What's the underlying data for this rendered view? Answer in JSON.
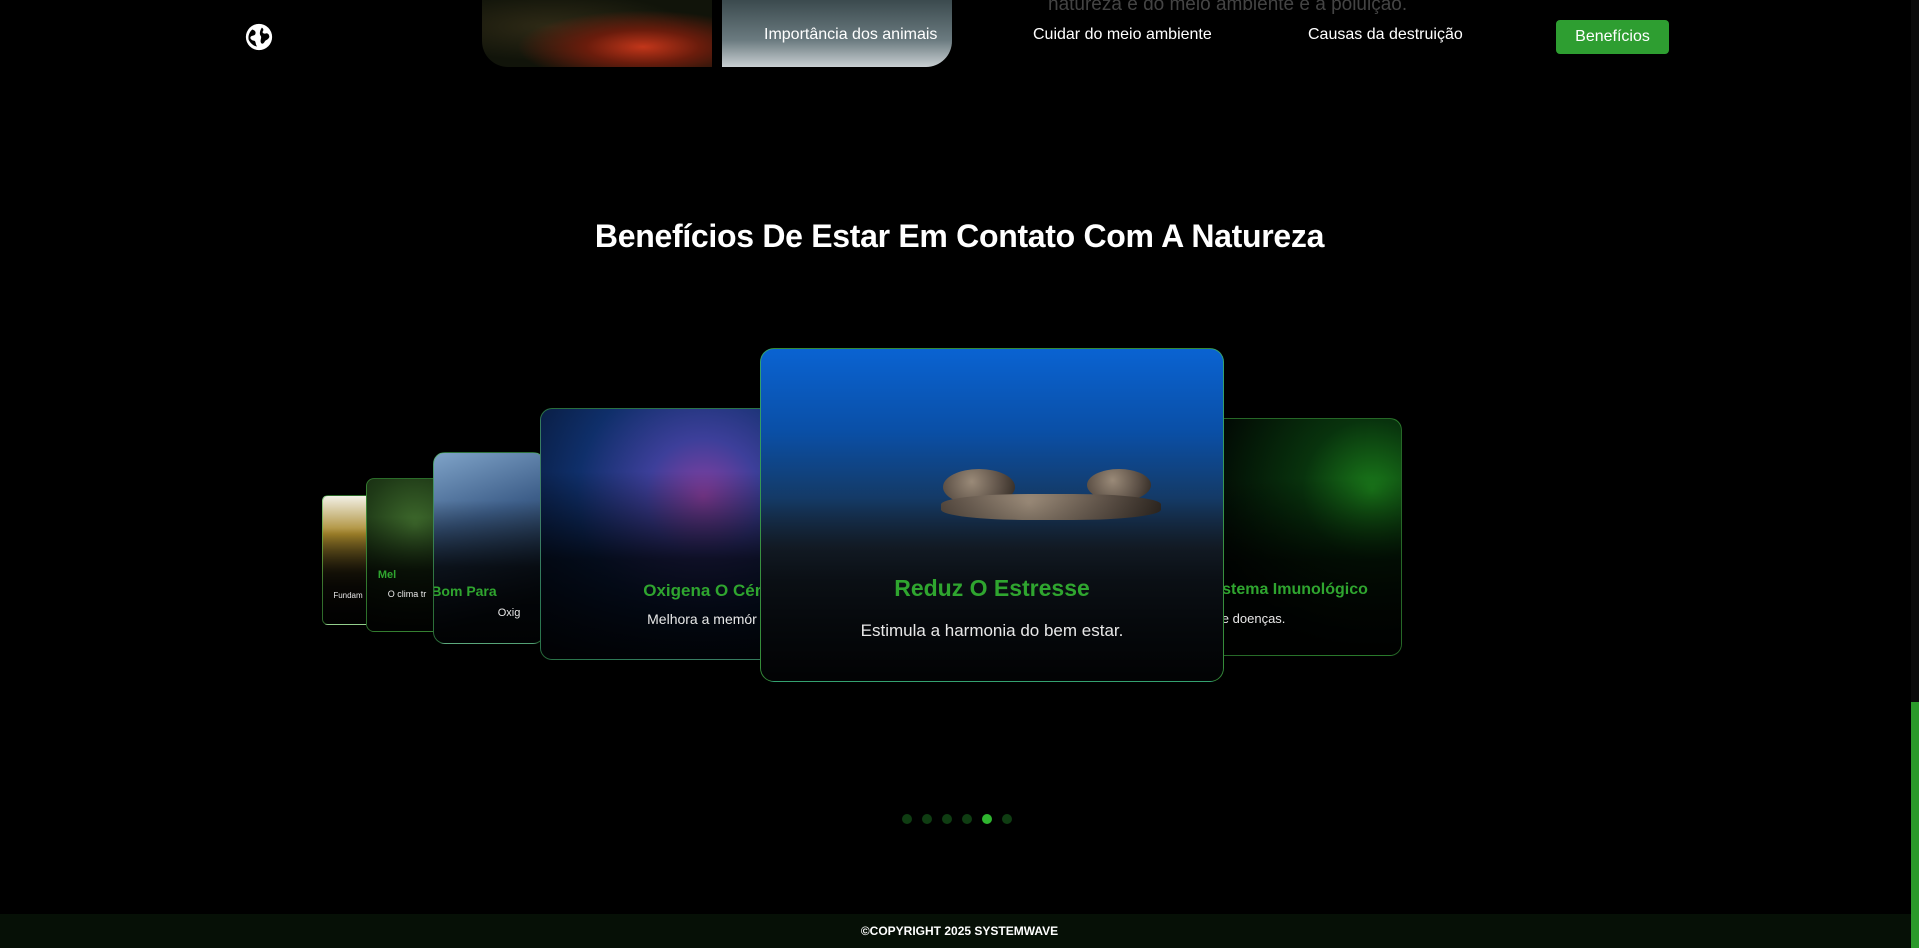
{
  "nav": {
    "peek_text": "natureza e do meio ambiente e a poluição.",
    "links": [
      "Importância dos animais",
      "Cuidar do meio ambiente",
      "Causas da destruição"
    ],
    "cta": "Benefícios"
  },
  "section": {
    "title": "Benefícios De Estar Em Contato Com A Natureza"
  },
  "cards": [
    {
      "title": "",
      "desc": "Fundam"
    },
    {
      "title": "Mel",
      "desc": "O clima tr"
    },
    {
      "title": "Bom Para",
      "desc": "Oxig"
    },
    {
      "title": "Oxigena O Cére",
      "desc": "Melhora a memór"
    },
    {
      "title": "Reduz O Estresse",
      "desc": "Estimula a harmonia do bem estar."
    },
    {
      "title": "stema Imunológico",
      "desc": "de doenças."
    }
  ],
  "pagination": {
    "count": 6,
    "active_index": 4
  },
  "footer": {
    "text": "©COPYRIGHT 2025 SYSTEMWAVE"
  },
  "colors": {
    "accent": "#2e9e31",
    "background": "#000000"
  }
}
